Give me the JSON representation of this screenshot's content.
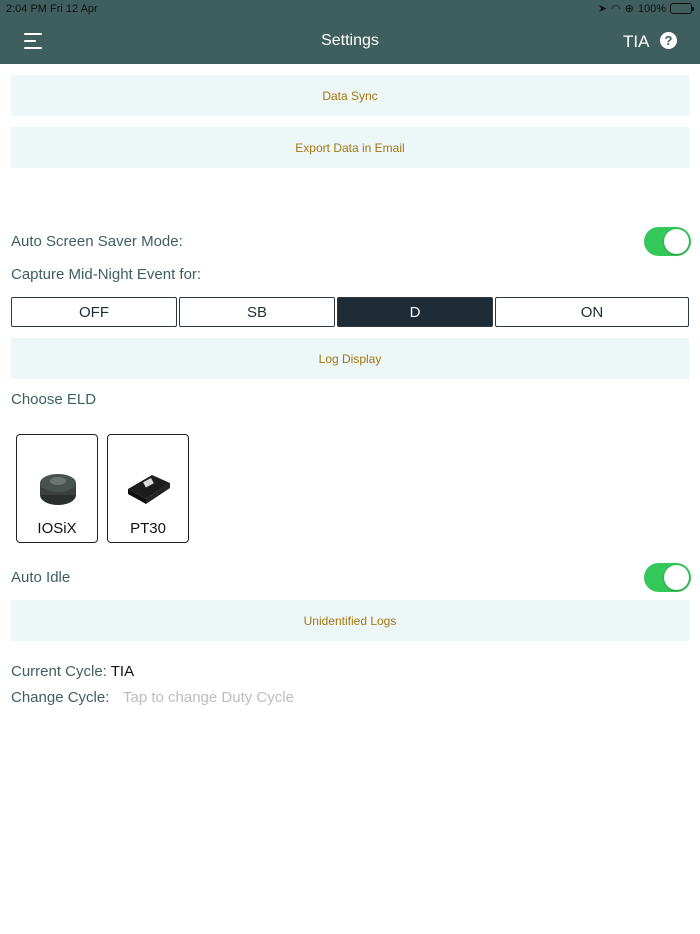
{
  "status_bar": {
    "time": "2:04 PM   Fri 12 Apr",
    "battery": "100%"
  },
  "header": {
    "title": "Settings",
    "cycle": "TIA"
  },
  "buttons": {
    "data_sync": "Data Sync",
    "export_email": "Export Data in Email",
    "log_display": "Log Display",
    "unidentified_logs": "Unidentified Logs"
  },
  "settings": {
    "auto_screen_saver": "Auto Screen Saver Mode:",
    "capture_midnight": "Capture Mid-Night Event for:",
    "choose_eld": "Choose ELD",
    "auto_idle": "Auto Idle",
    "current_cycle_label": "Current Cycle:",
    "current_cycle_value": "TIA",
    "change_cycle_label": "Change Cycle:",
    "change_cycle_placeholder": "Tap to change Duty Cycle"
  },
  "midnight_options": [
    "OFF",
    "SB",
    "D",
    "ON"
  ],
  "midnight_selected": "D",
  "eld_devices": [
    "IOSiX",
    "PT30"
  ],
  "toggles": {
    "auto_screen_saver": true,
    "auto_idle": true
  },
  "colors": {
    "header": "#3f5f5f",
    "accent_text": "#a0780e",
    "toggle_on": "#34c759",
    "segment_active": "#1f2c36"
  }
}
